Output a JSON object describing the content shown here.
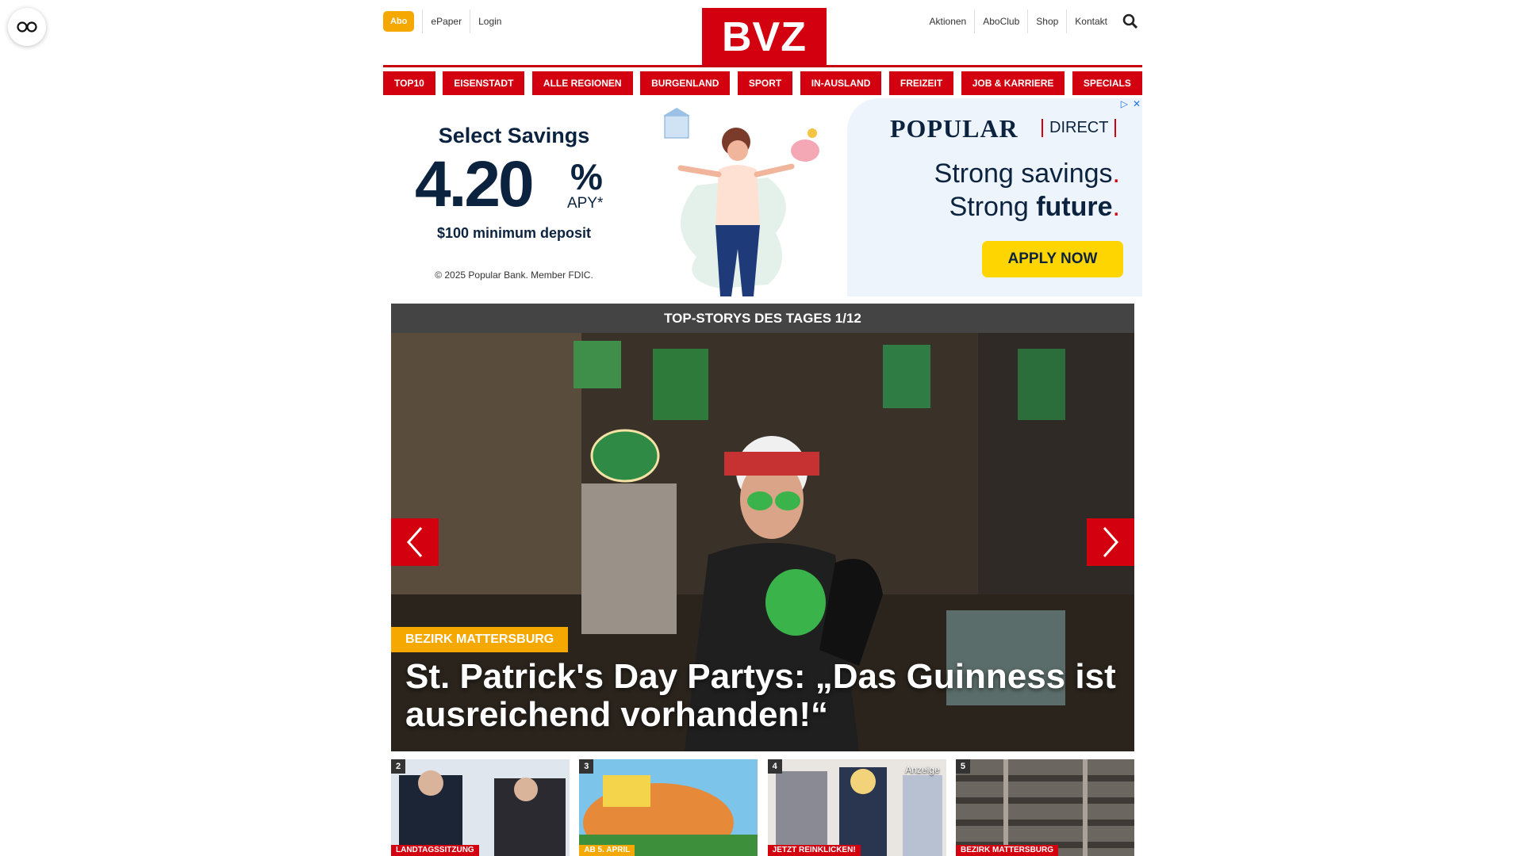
{
  "header": {
    "abo": "Abo",
    "left_links": [
      "ePaper",
      "Login"
    ],
    "logo": "BVZ",
    "right_links": [
      "Aktionen",
      "AboClub",
      "Shop",
      "Kontakt"
    ]
  },
  "nav": [
    "TOP10",
    "EISENSTADT",
    "ALLE REGIONEN",
    "BURGENLAND",
    "SPORT",
    "IN-AUSLAND",
    "FREIZEIT",
    "JOB & KARRIERE",
    "SPECIALS"
  ],
  "ad": {
    "title": "Select Savings",
    "rate": "4.20",
    "pct": "%",
    "apy": "APY*",
    "minimum": "$100 minimum deposit",
    "copyright": "© 2025 Popular Bank. Member FDIC.",
    "brand": "POPULAR",
    "brand_suffix": "DIRECT",
    "line1": "Strong savings",
    "line2_prefix": "Strong ",
    "line2_bold": "future",
    "cta": "APPLY NOW",
    "choice_icon": "adchoices-icon",
    "close_icon": "close-icon"
  },
  "slider": {
    "bar": "TOP-STORYS DES TAGES 1/12",
    "kicker": "BEZIRK MATTERSBURG",
    "headline": "St. Patrick's Day Partys: „Das Guinness ist ausreichend vorhanden!“"
  },
  "teasers": [
    {
      "num": "2",
      "tag": "LANDTAGSSITZUNG",
      "tag_color": "#d3000f"
    },
    {
      "num": "3",
      "tag": "AB 5. APRIL",
      "tag_color": "#f5a800"
    },
    {
      "num": "4",
      "tag": "JETZT REINKLICKEN!",
      "tag_color": "#d3000f",
      "badge": "Anzeige"
    },
    {
      "num": "5",
      "tag": "BEZIRK MATTERSBURG",
      "tag_color": "#d3000f"
    }
  ],
  "colors": {
    "brand_red": "#d3000f",
    "accent_orange": "#f5a800",
    "navy": "#0c2340",
    "cta_yellow": "#ffd500"
  }
}
